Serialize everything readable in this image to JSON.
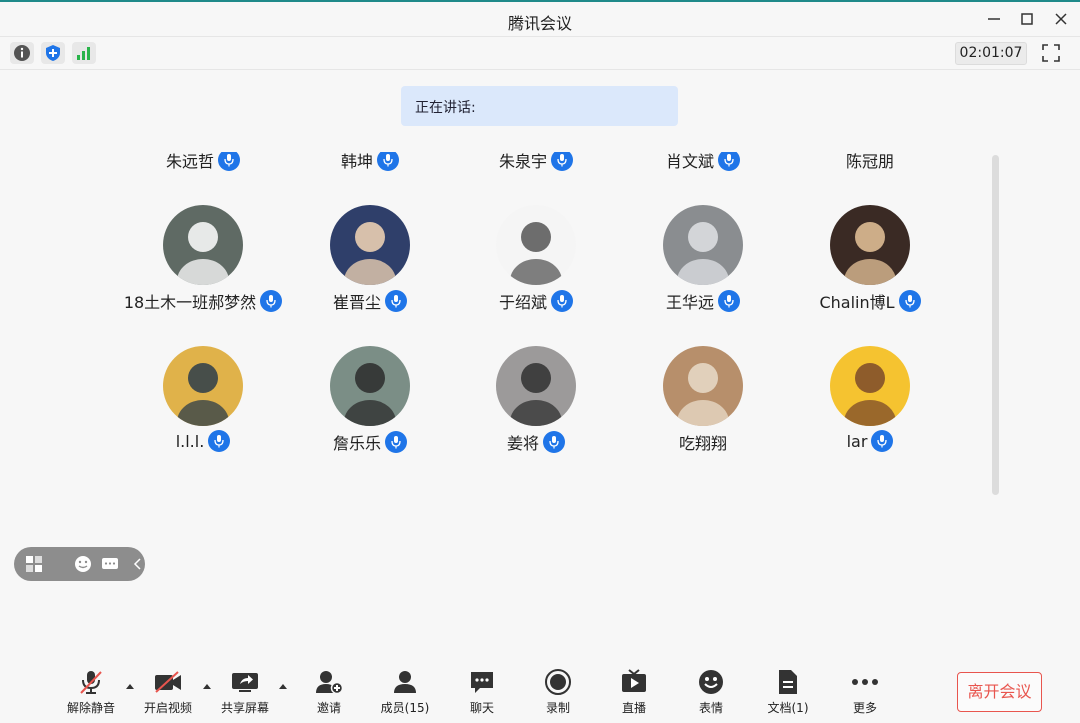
{
  "window": {
    "title": "腾讯会议"
  },
  "toolbar": {
    "timer": "02:01:07"
  },
  "speaking": {
    "label": "正在讲话:"
  },
  "participants": [
    {
      "name": "朱远哲",
      "mic": true,
      "bg": "#9a9a9a",
      "fg": "#d8d8d8"
    },
    {
      "name": "韩坤",
      "mic": true,
      "bg": "#4a88c9",
      "fg": "#f2a94a"
    },
    {
      "name": "朱泉宇",
      "mic": true,
      "bg": "#c9c9c9",
      "fg": "#3a3a3a"
    },
    {
      "name": "肖文斌",
      "mic": true,
      "bg": "#ffffff",
      "fg": "#d84040"
    },
    {
      "name": "陈冠朋",
      "mic": false,
      "bg": "#d9b9c2",
      "fg": "#6a3848"
    },
    {
      "name": "18土木一班郝梦然",
      "mic": true,
      "bg": "#5f6a64",
      "fg": "#ffffff"
    },
    {
      "name": "崔晋尘",
      "mic": true,
      "bg": "#2f3f6a",
      "fg": "#f4d7b6"
    },
    {
      "name": "于绍斌",
      "mic": true,
      "bg": "#f5f5f5",
      "fg": "#555555"
    },
    {
      "name": "王华远",
      "mic": true,
      "bg": "#8a8d90",
      "fg": "#dfe2e5"
    },
    {
      "name": "Chalin博L",
      "mic": true,
      "bg": "#3a2a24",
      "fg": "#e7c49a"
    },
    {
      "name": "l.l.l.",
      "mic": true,
      "bg": "#e0b24a",
      "fg": "#2c3c4a"
    },
    {
      "name": "詹乐乐",
      "mic": true,
      "bg": "#7b8e86",
      "fg": "#2b2b2b"
    },
    {
      "name": "姜将",
      "mic": true,
      "bg": "#9c9a9a",
      "fg": "#303030"
    },
    {
      "name": "吃翔翔",
      "mic": false,
      "bg": "#b78f6b",
      "fg": "#e9dcc9"
    },
    {
      "name": "lar",
      "mic": true,
      "bg": "#f5c330",
      "fg": "#7b4a2a"
    }
  ],
  "bottom": {
    "unmute": "解除静音",
    "start_video": "开启视频",
    "share_screen": "共享屏幕",
    "invite": "邀请",
    "members": "成员(15)",
    "chat": "聊天",
    "record": "录制",
    "live": "直播",
    "reactions": "表情",
    "docs": "文档(1)",
    "more": "更多",
    "leave": "离开会议"
  },
  "colors": {
    "accent": "#1f75e8",
    "leave": "#e8554e",
    "speaking_bg": "#dbe8fb"
  },
  "icons": [
    "info-icon",
    "shield-icon",
    "signal-icon",
    "fullscreen-icon",
    "mic-icon",
    "mic-muted-icon",
    "video-off-icon",
    "share-screen-icon",
    "invite-icon",
    "members-icon",
    "chat-icon",
    "record-icon",
    "live-icon",
    "emoji-icon",
    "document-icon",
    "more-icon",
    "grid-layout-icon",
    "collapse-icon"
  ]
}
